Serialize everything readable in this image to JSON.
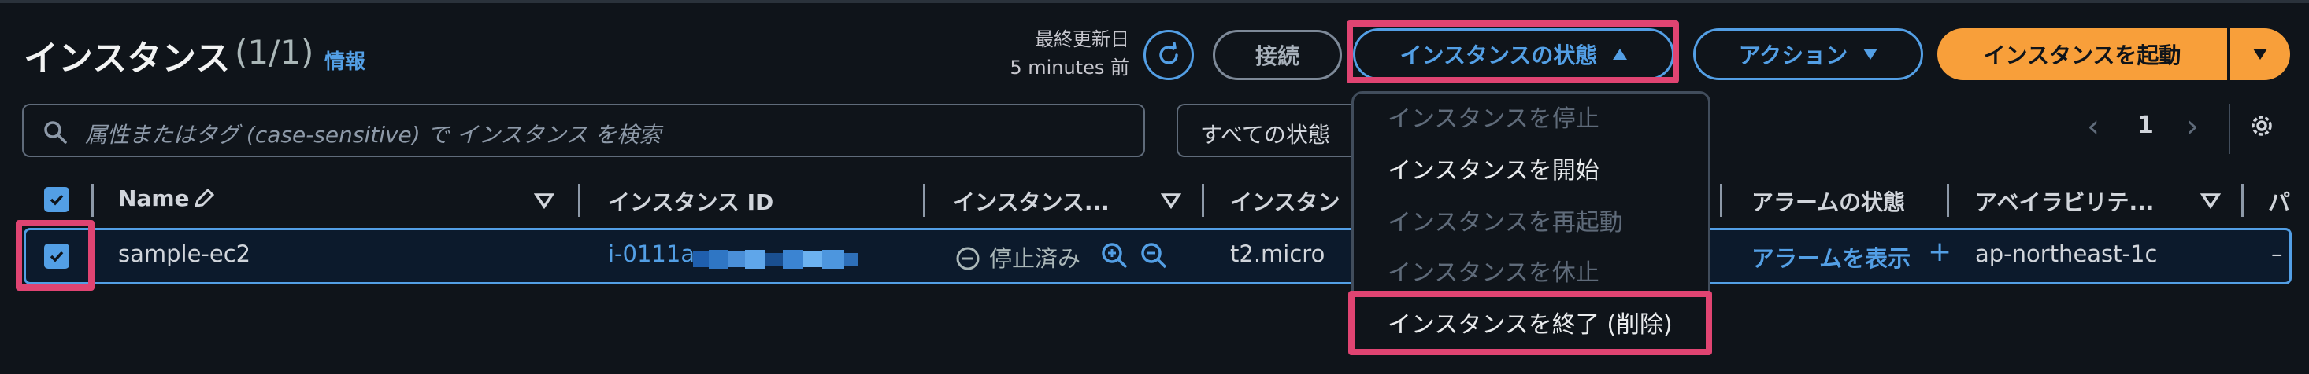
{
  "header": {
    "title": "インスタンス",
    "count": "(1/1)",
    "info": "情報",
    "last_updated_label": "最終更新日",
    "last_updated_value": "5 minutes 前"
  },
  "toolbar": {
    "connect": "接続",
    "instance_state": "インスタンスの状態",
    "actions": "アクション",
    "launch": "インスタンスを起動"
  },
  "search": {
    "placeholder": "属性またはタグ (case-sensitive) で インスタンス を検索"
  },
  "filter": {
    "value": "すべての状態"
  },
  "pagination": {
    "page": "1"
  },
  "table": {
    "columns": [
      "Name",
      "インスタンス ID",
      "インスタンス...",
      "インスタン",
      "アラームの状態",
      "アベイラビリテ...",
      "パ"
    ],
    "row": {
      "name": "sample-ec2",
      "instance_id": "i-0111a",
      "state": "停止済み",
      "type": "t2.micro",
      "alarm": "アラームを表示",
      "alarm_add": "+",
      "az": "ap-northeast-1c",
      "extra": "–"
    }
  },
  "state_menu": {
    "items": [
      {
        "label": "インスタンスを停止",
        "enabled": false
      },
      {
        "label": "インスタンスを開始",
        "enabled": true
      },
      {
        "label": "インスタンスを再起動",
        "enabled": false
      },
      {
        "label": "インスタンスを休止",
        "enabled": false
      },
      {
        "label": "インスタンスを終了 (削除)",
        "enabled": true
      }
    ]
  },
  "colors": {
    "accent": "#539fe5",
    "primary": "#f89f3a",
    "highlight": "#e04472",
    "background": "#0f141a"
  },
  "icons": [
    "refresh-icon",
    "search-icon",
    "edit-icon",
    "sort-icon",
    "stopped-icon",
    "zoom-in-icon",
    "zoom-out-icon",
    "gear-icon",
    "chevron-left-icon",
    "chevron-right-icon",
    "caret-down-icon",
    "caret-up-icon"
  ]
}
